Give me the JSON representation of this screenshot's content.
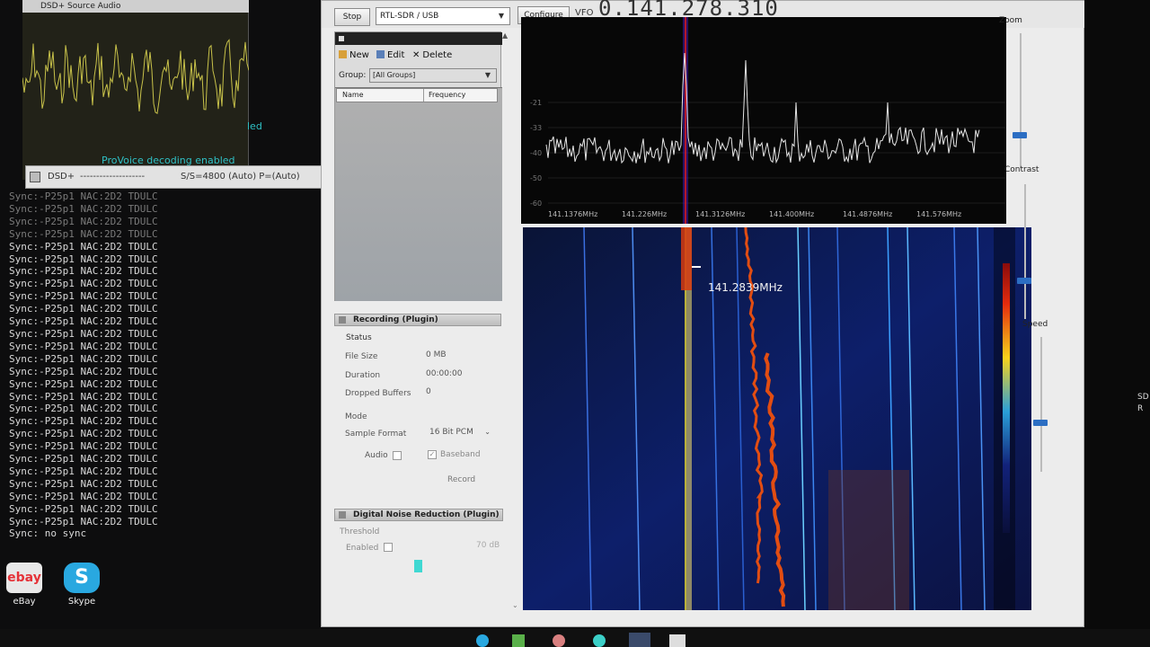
{
  "audio_window": {
    "title": "DSD+ Source Audio"
  },
  "console": {
    "teal_text1": "led",
    "teal_text2": "ProVoice decoding enabled",
    "dsd_title": "DSD+",
    "dsd_status": "S/S=4800 (Auto) P=(Auto)",
    "lines": [
      "Sync:-P25p1 NAC:2D2 TDULC",
      "Sync:-P25p1 NAC:2D2 TDULC",
      "Sync:-P25p1 NAC:2D2 TDULC",
      "Sync:-P25p1 NAC:2D2 TDULC",
      "Sync:-P25p1 NAC:2D2 TDULC",
      "Sync:-P25p1 NAC:2D2 TDULC",
      "Sync:-P25p1 NAC:2D2 TDULC",
      "Sync:-P25p1 NAC:2D2 TDULC",
      "Sync:-P25p1 NAC:2D2 TDULC",
      "Sync:-P25p1 NAC:2D2 TDULC",
      "Sync:-P25p1 NAC:2D2 TDULC",
      "Sync:-P25p1 NAC:2D2 TDULC",
      "Sync:-P25p1 NAC:2D2 TDULC",
      "Sync:-P25p1 NAC:2D2 TDULC",
      "Sync:-P25p1 NAC:2D2 TDULC",
      "Sync:-P25p1 NAC:2D2 TDULC",
      "Sync:-P25p1 NAC:2D2 TDULC",
      "Sync:-P25p1 NAC:2D2 TDULC",
      "Sync:-P25p1 NAC:2D2 TDULC",
      "Sync:-P25p1 NAC:2D2 TDULC",
      "Sync:-P25p1 NAC:2D2 TDULC",
      "Sync:-P25p1 NAC:2D2 TDULC",
      "Sync:-P25p1 NAC:2D2 TDULC",
      "Sync:-P25p1 NAC:2D2 TDULC",
      "Sync:-P25p1 NAC:2D2 TDULC",
      "Sync:-P25p1 NAC:2D2 TDULC",
      "Sync:-P25p1 NAC:2D2 TDULC",
      "Sync: no sync"
    ]
  },
  "desktop_icons": [
    {
      "label": "eBay",
      "color": "#e8e8e8"
    },
    {
      "label": "Skype",
      "color": "#29a8e0"
    }
  ],
  "toolbar": {
    "stop_label": "Stop",
    "source": "RTL-SDR / USB",
    "configure_label": "Configure",
    "vfo_label": "VFO",
    "vfo_value": "0.141.278.310"
  },
  "frequency_manager": {
    "new_label": "New",
    "edit_label": "Edit",
    "delete_label": "Delete",
    "group_label": "Group:",
    "group_value": "[All Groups]",
    "col_name": "Name",
    "col_frequency": "Frequency"
  },
  "recording": {
    "header": "Recording (Plugin)",
    "status_label": "Status",
    "file_size_label": "File Size",
    "file_size_value": "0 MB",
    "duration_label": "Duration",
    "duration_value": "00:00:00",
    "dropped_label": "Dropped Buffers",
    "dropped_value": "0",
    "mode_label": "Mode",
    "sample_format_label": "Sample Format",
    "sample_format_value": "16 Bit PCM",
    "audio_label": "Audio",
    "baseband_label": "Baseband",
    "record_label": "Record"
  },
  "dnr": {
    "header": "Digital Noise Reduction (Plugin)",
    "threshold_label": "Threshold",
    "enabled_label": "Enabled",
    "db_value": "70 dB"
  },
  "spectrum": {
    "y_ticks": [
      "-21",
      "-33",
      "-40",
      "-50",
      "-60"
    ],
    "x_ticks": [
      "141.1376MHz",
      "141.226MHz",
      "141.3126MHz",
      "141.400MHz",
      "141.4876MHz",
      "141.576MHz"
    ],
    "cursor_label": "141.2839MHz"
  },
  "right_controls": {
    "zoom_label": "Zoom",
    "contrast_label": "Contrast",
    "speed_label": "Speed"
  },
  "edge_text": [
    "SD",
    "R"
  ],
  "colors": {
    "accent_blue": "#2c6ec3",
    "console_teal": "#2fc1c6",
    "trace_yellow": "#c8c24a"
  }
}
